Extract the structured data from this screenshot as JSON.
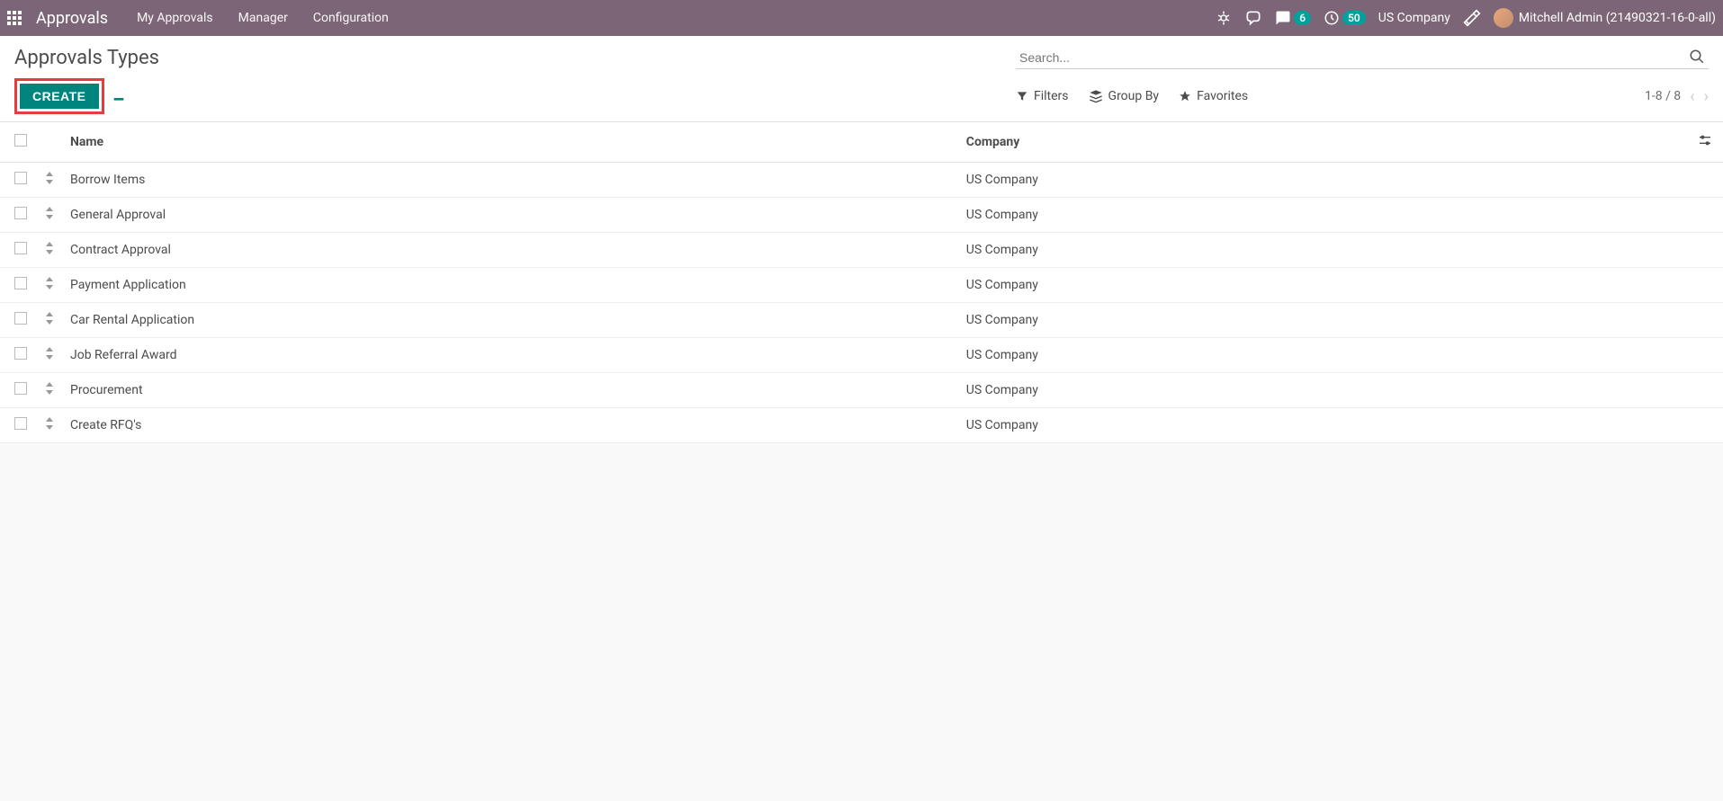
{
  "nav": {
    "brand": "Approvals",
    "items": [
      {
        "label": "My Approvals"
      },
      {
        "label": "Manager"
      },
      {
        "label": "Configuration"
      }
    ],
    "messages_badge": "6",
    "activities_badge": "50",
    "company": "US Company",
    "user": "Mitchell Admin (21490321-16-0-all)"
  },
  "page": {
    "title": "Approvals Types",
    "search_placeholder": "Search...",
    "create_label": "Create",
    "filters_label": "Filters",
    "groupby_label": "Group By",
    "favorites_label": "Favorites",
    "pager_text": "1-8 / 8"
  },
  "table": {
    "headers": {
      "name": "Name",
      "company": "Company"
    },
    "rows": [
      {
        "name": "Borrow Items",
        "company": "US Company"
      },
      {
        "name": "General Approval",
        "company": "US Company"
      },
      {
        "name": "Contract Approval",
        "company": "US Company"
      },
      {
        "name": "Payment Application",
        "company": "US Company"
      },
      {
        "name": "Car Rental Application",
        "company": "US Company"
      },
      {
        "name": "Job Referral Award",
        "company": "US Company"
      },
      {
        "name": "Procurement",
        "company": "US Company"
      },
      {
        "name": "Create RFQ's",
        "company": "US Company"
      }
    ]
  }
}
